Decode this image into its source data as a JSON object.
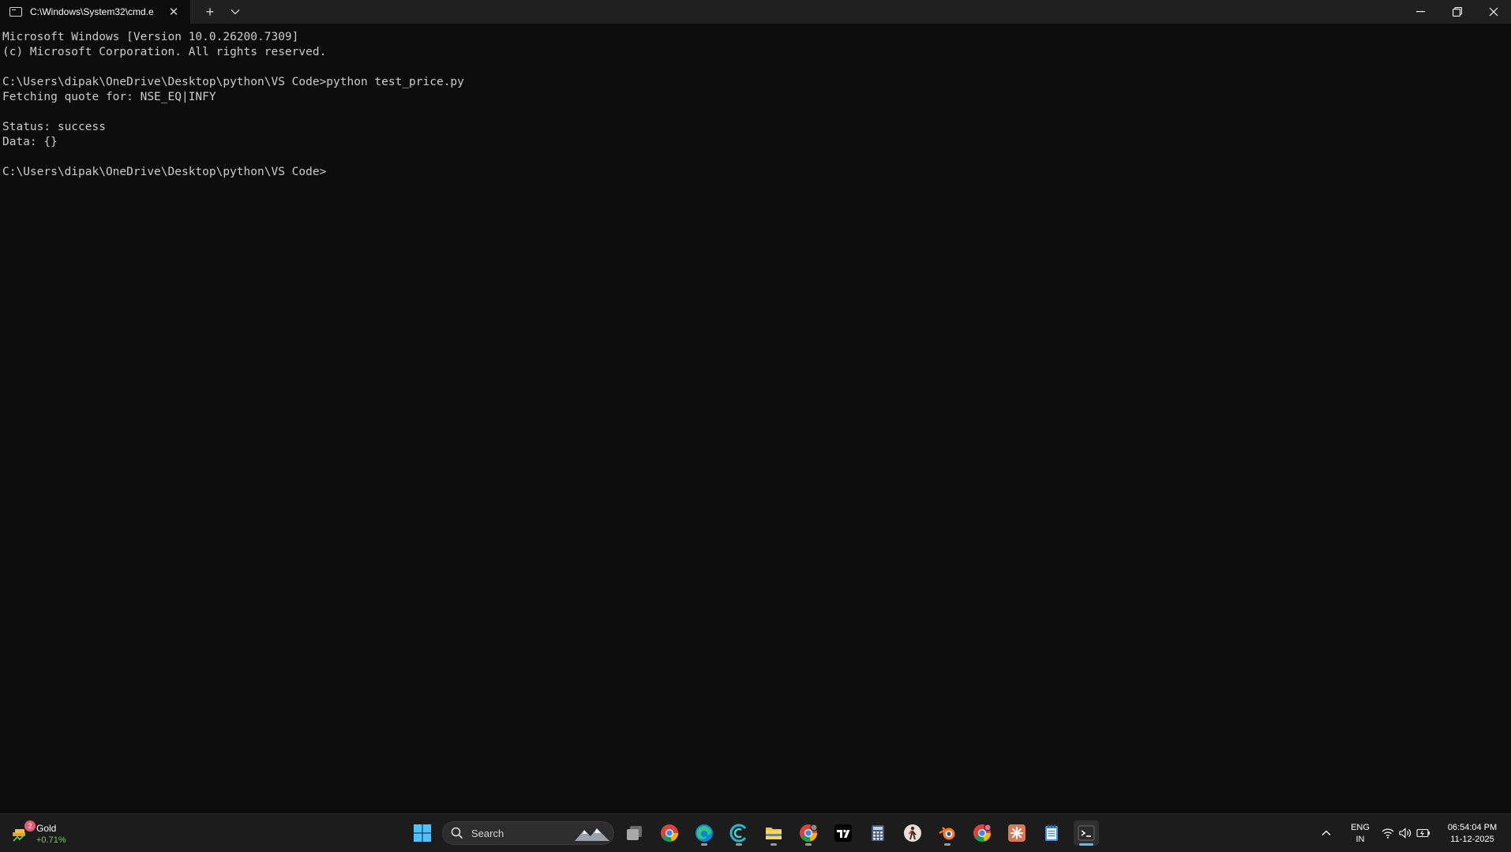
{
  "window": {
    "tab_title": "C:\\Windows\\System32\\cmd.e",
    "tab_close_glyph": "✕",
    "new_tab_glyph": "+"
  },
  "terminal": {
    "lines": [
      "Microsoft Windows [Version 10.0.26200.7309]",
      "(c) Microsoft Corporation. All rights reserved.",
      "",
      "C:\\Users\\dipak\\OneDrive\\Desktop\\python\\VS Code>python test_price.py",
      "Fetching quote for: NSE_EQ|INFY",
      "",
      "Status: success",
      "Data: {}",
      "",
      "C:\\Users\\dipak\\OneDrive\\Desktop\\python\\VS Code>"
    ]
  },
  "taskbar": {
    "widget": {
      "name": "Gold",
      "change": "+0.71%",
      "badge": "2"
    },
    "search_placeholder": "Search",
    "apps": [
      "task-view",
      "chrome",
      "edge",
      "copilot",
      "file-explorer",
      "chrome-profile",
      "tradingview",
      "calculator",
      "figure-app",
      "blender",
      "chrome-profile-2",
      "claude",
      "notepad",
      "terminal"
    ],
    "language": {
      "line1": "ENG",
      "line2": "IN"
    },
    "clock": {
      "time": "06:54:04 PM",
      "date": "11-12-2025"
    }
  },
  "colors": {
    "terminal_bg": "#0c0c0c",
    "terminal_fg": "#cccccc",
    "titlebar_bg": "#202020",
    "taskbar_bg": "#1c1c1c",
    "accent": "#4cc2ff"
  }
}
